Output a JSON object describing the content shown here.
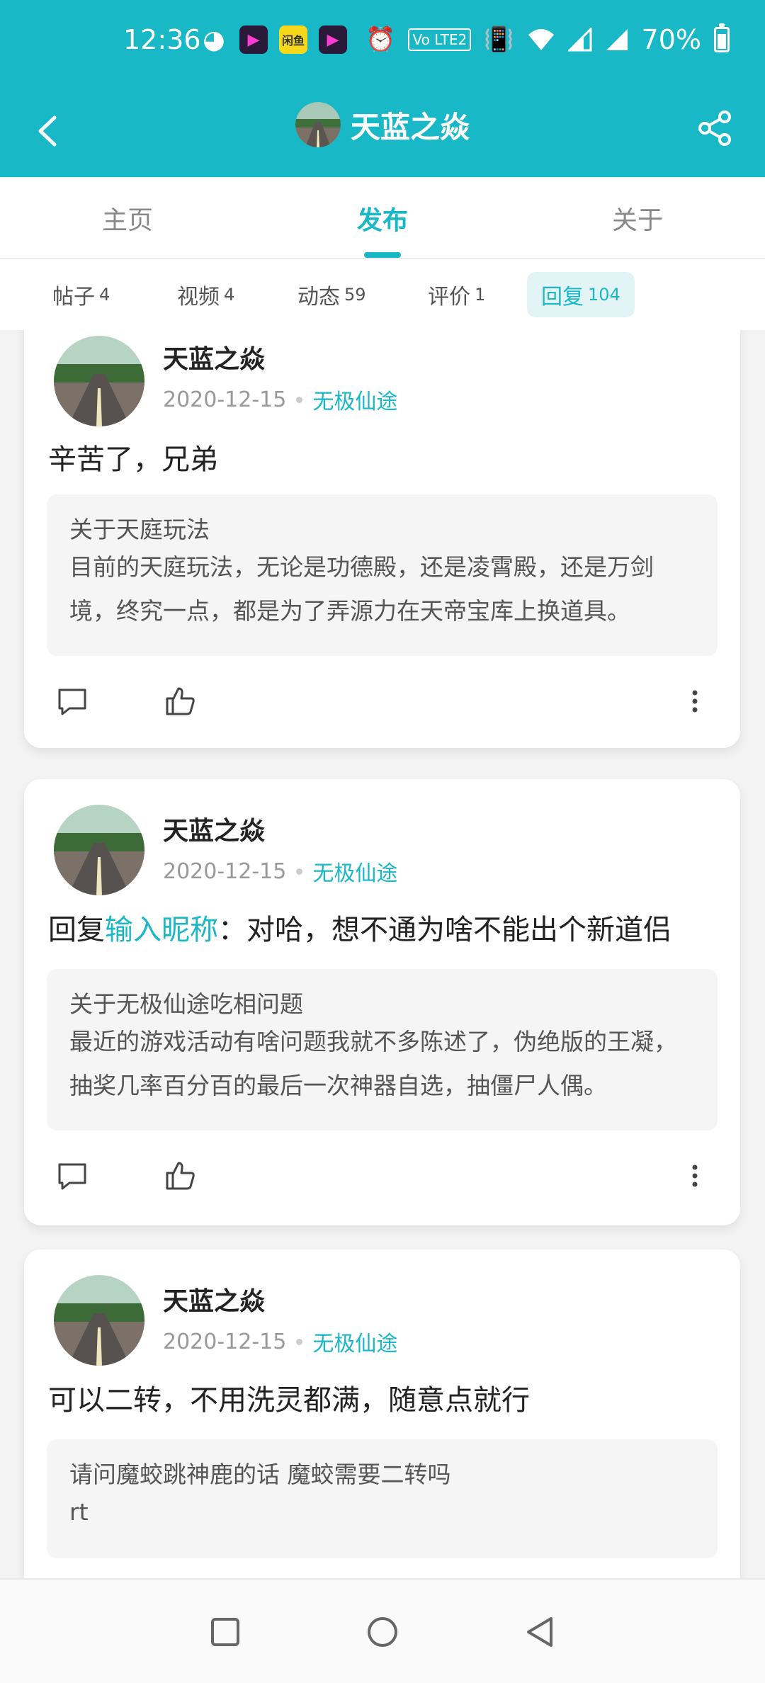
{
  "status_bar": {
    "time": "12:36",
    "app2_label": "闲鱼",
    "battery": "70%",
    "lte_label": "Vo LTE2"
  },
  "header": {
    "title": "天蓝之焱"
  },
  "tabs": [
    {
      "label": "主页"
    },
    {
      "label": "发布"
    },
    {
      "label": "关于"
    }
  ],
  "subtabs": [
    {
      "label": "帖子",
      "count": "4"
    },
    {
      "label": "视频",
      "count": "4"
    },
    {
      "label": "动态",
      "count": "59"
    },
    {
      "label": "评价",
      "count": "1"
    },
    {
      "label": "回复",
      "count": "104"
    }
  ],
  "posts": [
    {
      "author": "天蓝之焱",
      "date": "2020-12-15",
      "game": "无极仙途",
      "content": "辛苦了，兄弟",
      "quote_title": "关于天庭玩法",
      "quote_body": "目前的天庭玩法，无论是功德殿，还是凌霄殿，还是万剑境，终究一点，都是为了弄源力在天帝宝库上换道具。"
    },
    {
      "author": "天蓝之焱",
      "date": "2020-12-15",
      "game": "无极仙途",
      "content_prefix": "回复",
      "mention": "输入昵称",
      "content": "：对哈，想不通为啥不能出个新道侣",
      "quote_title": "关于无极仙途吃相问题",
      "quote_body": "最近的游戏活动有啥问题我就不多陈述了，伪绝版的王凝，抽奖几率百分百的最后一次神器自选，抽僵尸人偶。"
    },
    {
      "author": "天蓝之焱",
      "date": "2020-12-15",
      "game": "无极仙途",
      "content": "可以二转，不用洗灵都满，随意点就行",
      "quote_title": "请问魔蛟跳神鹿的话 魔蛟需要二转吗",
      "quote_body": "rt"
    }
  ],
  "colors": {
    "accent": "#19b8c6",
    "header_bg": "#19b8c6"
  }
}
